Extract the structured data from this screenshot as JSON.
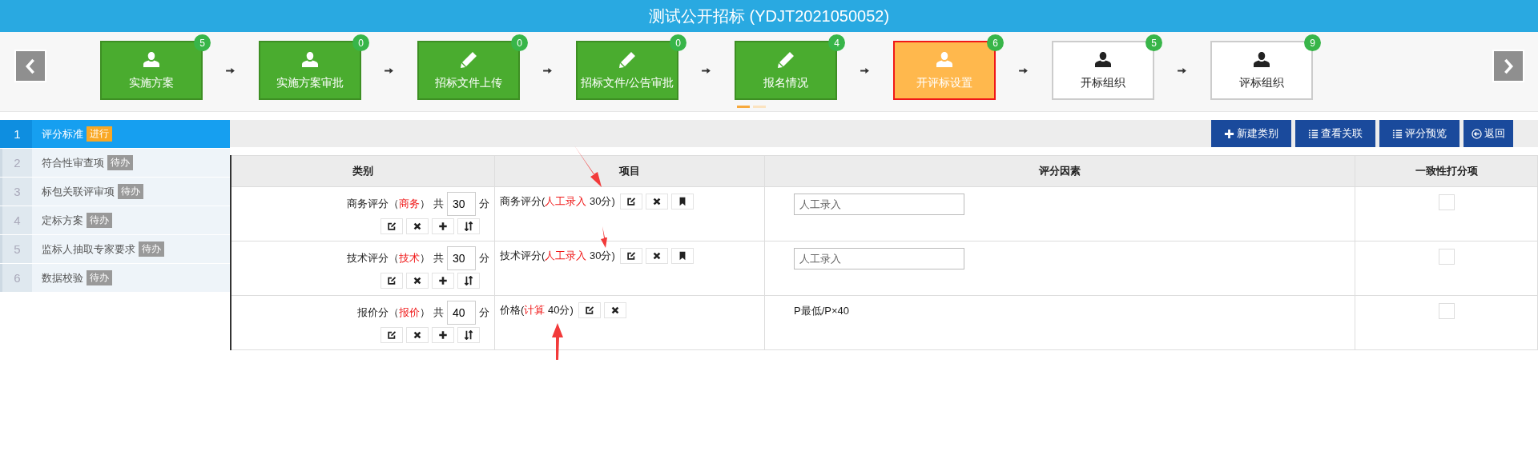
{
  "window": {
    "title": "测试公开招标 (YDJT2021050052)"
  },
  "steps": [
    {
      "label": "实施方案",
      "count": "5",
      "kind": "person",
      "completed": true,
      "selected": false
    },
    {
      "label": "实施方案审批",
      "count": "0",
      "kind": "person",
      "completed": true,
      "selected": false
    },
    {
      "label": "招标文件上传",
      "count": "0",
      "kind": "pencil",
      "completed": true,
      "selected": false
    },
    {
      "label": "招标文件/公告审批",
      "count": "0",
      "kind": "pencil",
      "completed": true,
      "selected": false
    },
    {
      "label": "报名情况",
      "count": "4",
      "kind": "pencil",
      "completed": true,
      "selected": false
    },
    {
      "label": "开评标设置",
      "count": "6",
      "kind": "person",
      "completed": false,
      "selected": true
    },
    {
      "label": "开标组织",
      "count": "5",
      "kind": "person",
      "completed": false,
      "selected": false
    },
    {
      "label": "评标组织",
      "count": "9",
      "kind": "person",
      "completed": false,
      "selected": false
    }
  ],
  "pager": [
    {
      "selected": true
    },
    {
      "selected": false
    }
  ],
  "sidebar": {
    "items": [
      {
        "number": "1",
        "label": "评分标准",
        "badge": "进行",
        "selected": true
      },
      {
        "number": "2",
        "label": "符合性审查项",
        "badge": "待办",
        "selected": false
      },
      {
        "number": "3",
        "label": "标包关联评审项",
        "badge": "待办",
        "selected": false
      },
      {
        "number": "4",
        "label": "定标方案",
        "badge": "待办",
        "selected": false
      },
      {
        "number": "5",
        "label": "监标人抽取专家要求",
        "badge": "待办",
        "selected": false
      },
      {
        "number": "6",
        "label": "数据校验",
        "badge": "待办",
        "selected": false
      }
    ]
  },
  "toolbar": [
    {
      "label": "新建类别",
      "kind": "plus"
    },
    {
      "label": "查看关联",
      "kind": "list"
    },
    {
      "label": "评分预览",
      "kind": "list"
    },
    {
      "label": "返回",
      "kind": "back"
    }
  ],
  "table": {
    "columns": [
      "类别",
      "项目",
      "评分因素",
      "一致性打分项"
    ],
    "rows": [
      {
        "category": {
          "prefix": "商务评分（",
          "code": "商务",
          "suffix": "） 共",
          "score": "30",
          "unit": "分"
        },
        "category_actions": [
          {
            "kind": "edit"
          },
          {
            "kind": "delete"
          },
          {
            "kind": "add"
          },
          {
            "kind": "sort"
          }
        ],
        "item": {
          "prefix": "商务评分(",
          "method": "人工录入",
          "suffix": " 30分)"
        },
        "item_actions": [
          {
            "kind": "edit"
          },
          {
            "kind": "delete"
          },
          {
            "kind": "bookmark"
          }
        ],
        "factor": {
          "kind": "field",
          "value": "人工录入"
        },
        "consistency_checked": false
      },
      {
        "category": {
          "prefix": "技术评分（",
          "code": "技术",
          "suffix": "） 共",
          "score": "30",
          "unit": "分"
        },
        "category_actions": [
          {
            "kind": "edit"
          },
          {
            "kind": "delete"
          },
          {
            "kind": "add"
          },
          {
            "kind": "sort"
          }
        ],
        "item": {
          "prefix": "技术评分(",
          "method": "人工录入",
          "suffix": " 30分)"
        },
        "item_actions": [
          {
            "kind": "edit"
          },
          {
            "kind": "delete"
          },
          {
            "kind": "bookmark"
          }
        ],
        "factor": {
          "kind": "field",
          "value": "人工录入"
        },
        "consistency_checked": false
      },
      {
        "category": {
          "prefix": "报价分（",
          "code": "报价",
          "suffix": "） 共",
          "score": "40",
          "unit": "分"
        },
        "category_actions": [
          {
            "kind": "edit"
          },
          {
            "kind": "delete"
          },
          {
            "kind": "add"
          },
          {
            "kind": "sort"
          }
        ],
        "item": {
          "prefix": "价格(",
          "method": "计算",
          "suffix": " 40分)"
        },
        "item_actions": [
          {
            "kind": "edit"
          },
          {
            "kind": "delete"
          }
        ],
        "factor": {
          "kind": "text",
          "text": "P最低/P×40"
        },
        "consistency_checked": false
      }
    ]
  }
}
